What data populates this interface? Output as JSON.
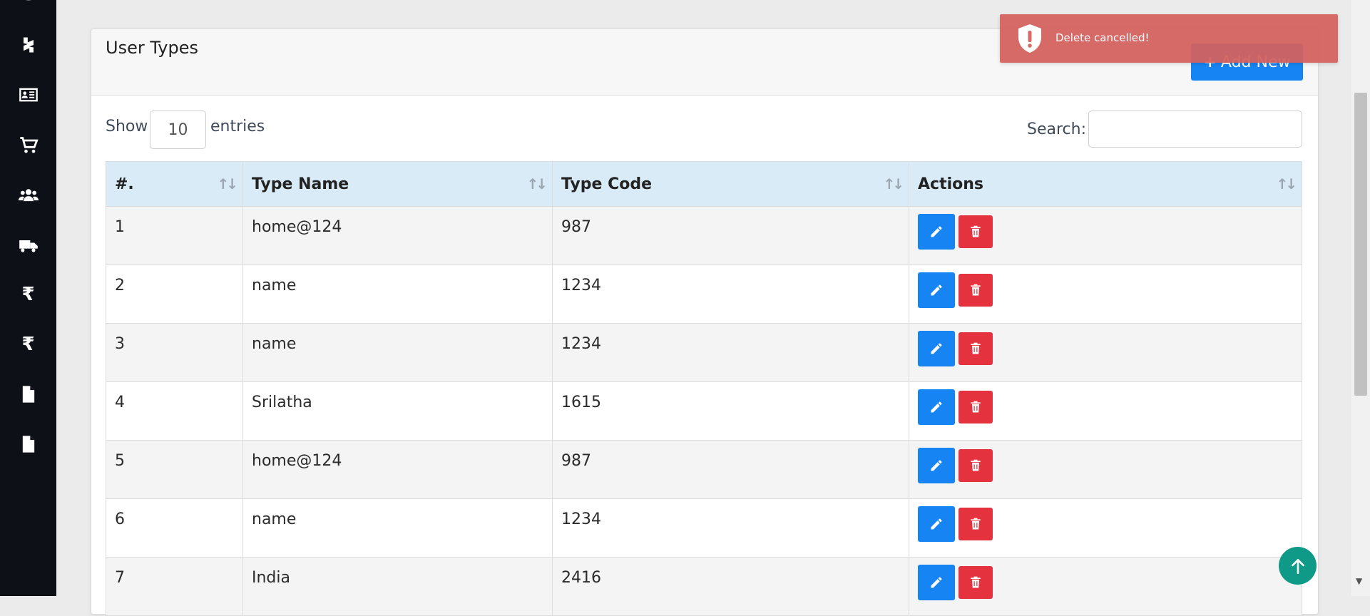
{
  "sidebar": {
    "items": [
      {
        "icon": "database-icon"
      },
      {
        "icon": "brand-s-icon"
      },
      {
        "icon": "id-card-icon"
      },
      {
        "icon": "cart-icon"
      },
      {
        "icon": "users-icon"
      },
      {
        "icon": "truck-icon"
      },
      {
        "icon": "rupee-icon",
        "glyph": "₹"
      },
      {
        "icon": "rupee-icon",
        "glyph": "₹"
      },
      {
        "icon": "file-icon"
      },
      {
        "icon": "file-icon"
      }
    ]
  },
  "card": {
    "title": "User Types",
    "add_button_label": "Add New",
    "add_button_icon": "plus-icon"
  },
  "controls": {
    "show_label": "Show",
    "page_length": "10",
    "entries_label": "entries",
    "search_label": "Search:",
    "search_value": ""
  },
  "table": {
    "columns": [
      "#.",
      "Type Name",
      "Type Code",
      "Actions"
    ],
    "rows": [
      {
        "num": "1",
        "name": "home@124",
        "code": "987"
      },
      {
        "num": "2",
        "name": "name",
        "code": "1234"
      },
      {
        "num": "3",
        "name": "name",
        "code": "1234"
      },
      {
        "num": "4",
        "name": "Srilatha",
        "code": "1615"
      },
      {
        "num": "5",
        "name": "home@124",
        "code": "987"
      },
      {
        "num": "6",
        "name": "name",
        "code": "1234"
      },
      {
        "num": "7",
        "name": "India",
        "code": "2416"
      }
    ]
  },
  "toast": {
    "message": "Delete cancelled!",
    "icon": "shield-alert-icon"
  },
  "colors": {
    "primary": "#1685f3",
    "danger": "#e4323f",
    "toast_bg": "#d4625f",
    "header_bg": "#d9ebf6",
    "sidebar_bg": "#0d1117",
    "to_top": "#0f9a88"
  }
}
